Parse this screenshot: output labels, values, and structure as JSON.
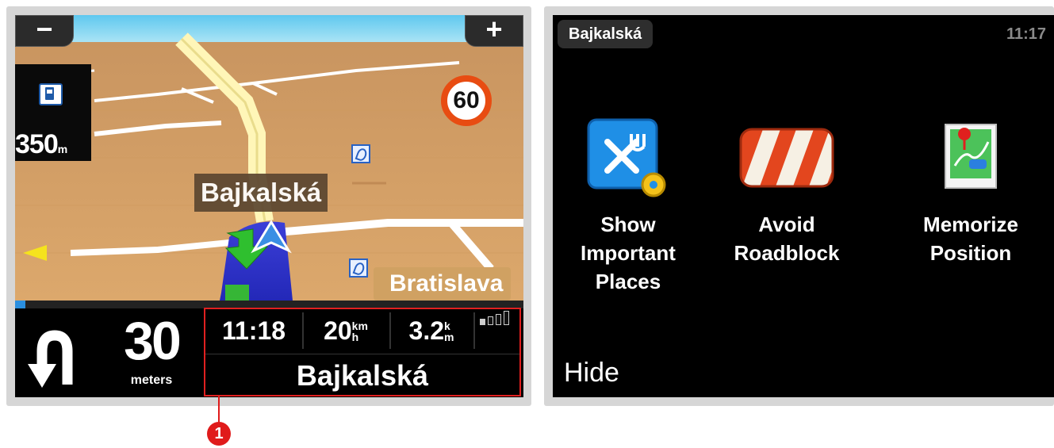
{
  "nav": {
    "zoom_out_label": "−",
    "zoom_in_label": "+",
    "poi_distance_value": "350",
    "poi_distance_unit": "m",
    "speed_limit": "60",
    "current_street": "Bajkalská",
    "city_label": "Bratislava",
    "route_progress": 0.02,
    "turn_distance": "30",
    "turn_distance_unit": "meters",
    "eta": "11:18",
    "speed_value": "20",
    "speed_unit_top": "km",
    "speed_unit_bottom": "h",
    "remaining_value": "3.2",
    "remaining_unit_top": "k",
    "remaining_unit_bottom": "m",
    "next_street": "Bajkalská",
    "gps_signal": 1
  },
  "callout": {
    "number": "1"
  },
  "menu": {
    "title": "Bajkalská",
    "clock": "11:17",
    "items": [
      {
        "label": "Show\nImportant\nPlaces",
        "icon": "show-important-places-icon"
      },
      {
        "label": "Avoid\nRoadblock",
        "icon": "roadblock-icon"
      },
      {
        "label": "Memorize\nPosition",
        "icon": "memorize-position-icon"
      }
    ],
    "hide_label": "Hide"
  },
  "colors": {
    "speed_sign_ring": "#e84c12",
    "callout": "#e01b1b",
    "map_ground": "#d6a064",
    "progress": "#2a8fe0"
  }
}
